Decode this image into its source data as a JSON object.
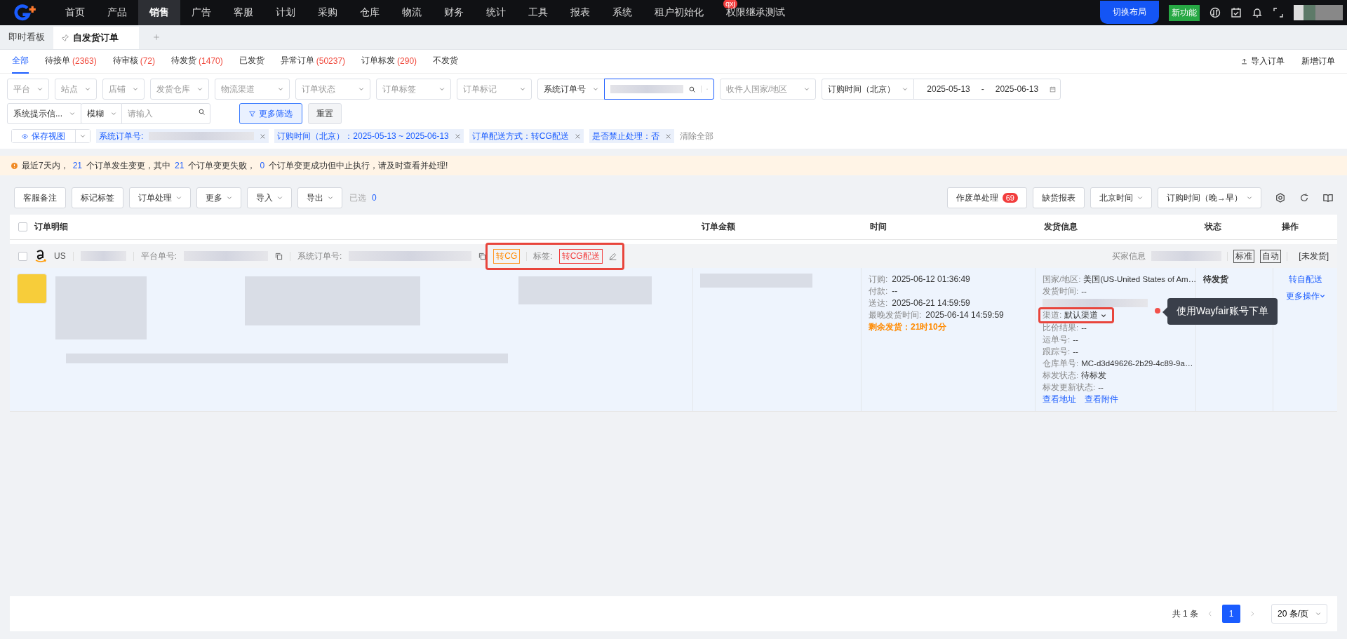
{
  "top_nav": {
    "items": [
      {
        "label": "首页",
        "selected": false
      },
      {
        "label": "产品",
        "selected": false
      },
      {
        "label": "销售",
        "selected": true
      },
      {
        "label": "广告",
        "selected": false
      },
      {
        "label": "客服",
        "selected": false
      },
      {
        "label": "计划",
        "selected": false
      },
      {
        "label": "采购",
        "selected": false
      },
      {
        "label": "仓库",
        "selected": false
      },
      {
        "label": "物流",
        "selected": false
      },
      {
        "label": "财务",
        "selected": false
      },
      {
        "label": "统计",
        "selected": false
      },
      {
        "label": "工具",
        "selected": false
      },
      {
        "label": "报表",
        "selected": false
      },
      {
        "label": "系统",
        "selected": false
      },
      {
        "label": "租户初始化",
        "selected": false
      },
      {
        "label": "权限继承测试",
        "selected": false,
        "badge": "qxj"
      }
    ],
    "switch_layout": "切换布局",
    "new_feature": "新功能"
  },
  "page_tabs": [
    {
      "label": "即时看板",
      "selected": false,
      "pinned": false
    },
    {
      "label": "自发货订单",
      "selected": true,
      "pinned": true
    }
  ],
  "status_tabs": [
    {
      "label": "全部",
      "selected": true
    },
    {
      "label": "待接单",
      "count": "(2363)",
      "selected": false
    },
    {
      "label": "待审核",
      "count": "(72)",
      "selected": false
    },
    {
      "label": "待发货",
      "count": "(1470)",
      "selected": false
    },
    {
      "label": "已发货",
      "selected": false
    },
    {
      "label": "异常订单",
      "count": "(50237)",
      "selected": false
    },
    {
      "label": "订单标发",
      "count": "(290)",
      "selected": false
    },
    {
      "label": "不发货",
      "selected": false
    }
  ],
  "header_actions": [
    {
      "label": "导入订单",
      "kind": "upload"
    },
    {
      "label": "新增订单",
      "kind": "plain"
    }
  ],
  "filter_rows": [
    [
      {
        "kind": "select",
        "placeholder": "平台"
      },
      {
        "kind": "select",
        "placeholder": "站点"
      },
      {
        "kind": "select",
        "placeholder": "店铺"
      },
      {
        "kind": "select",
        "placeholder": "发货仓库"
      },
      {
        "kind": "select",
        "placeholder": "物流渠道",
        "wide": true
      },
      {
        "kind": "select",
        "placeholder": "订单状态",
        "wide": true
      },
      {
        "kind": "select",
        "placeholder": "订单标签",
        "wide": true
      },
      {
        "kind": "select",
        "placeholder": "订单标记",
        "wide": true
      },
      {
        "kind": "group",
        "items": [
          {
            "kind": "select",
            "value": "系统订单号"
          },
          {
            "kind": "search",
            "redacted": true,
            "focused": true,
            "more": true
          }
        ]
      },
      {
        "kind": "select",
        "placeholder": "收件人国家/地区",
        "wide": true
      },
      {
        "kind": "group",
        "items": [
          {
            "kind": "select",
            "value": "订购时间（北京）"
          },
          {
            "kind": "daterange",
            "start": "2025-05-13",
            "separator": "-",
            "end": "2025-06-13"
          }
        ]
      }
    ],
    [
      {
        "kind": "group",
        "items": [
          {
            "kind": "select",
            "value": "系统提示信..."
          },
          {
            "kind": "select",
            "value": "模糊"
          },
          {
            "kind": "search",
            "placeholder": "请输入"
          }
        ]
      },
      {
        "kind": "button",
        "label": "更多筛选",
        "primary": true
      },
      {
        "kind": "button",
        "label": "重置",
        "primary": false
      }
    ]
  ],
  "save_view": "保存视图",
  "chips": [
    {
      "label": "系统订单号:",
      "redacted": true
    },
    {
      "label": "订购时间（北京）：2025-05-13 ~ 2025-06-13"
    },
    {
      "label": "订单配送方式：转CG配送"
    },
    {
      "label": "是否禁止处理：否"
    }
  ],
  "clear_all": "清除全部",
  "alert": [
    {
      "kind": "text",
      "text": "最近7天内，"
    },
    {
      "kind": "count",
      "text": "21"
    },
    {
      "kind": "text",
      "text": "个订单发生变更，其中"
    },
    {
      "kind": "count",
      "text": "21"
    },
    {
      "kind": "text",
      "text": "个订单变更失败，"
    },
    {
      "kind": "count",
      "text": "0"
    },
    {
      "kind": "text",
      "text": "个订单变更成功但中止执行，请及时查看并处理!"
    }
  ],
  "toolbar": {
    "left": [
      {
        "label": "客服备注",
        "dropdown": false
      },
      {
        "label": "标记标签",
        "dropdown": false
      },
      {
        "label": "订单处理",
        "dropdown": true
      },
      {
        "label": "更多",
        "dropdown": true
      },
      {
        "label": "导入",
        "dropdown": true
      },
      {
        "label": "导出",
        "dropdown": true
      }
    ],
    "selected_label": "已选",
    "selected_count": "0",
    "right": [
      {
        "label": "作废单处理",
        "badge": "69",
        "dropdown": false
      },
      {
        "label": "缺货报表",
        "dropdown": false
      },
      {
        "label": "北京时间",
        "dropdown": true
      },
      {
        "label": "订购时间（晚→早）",
        "dropdown": true
      }
    ]
  },
  "table": {
    "select_all_checked": false,
    "columns": [
      "订单明细",
      "订单金额",
      "时间",
      "发货信息",
      "状态",
      "操作"
    ],
    "order": {
      "checked": false,
      "site": "US",
      "platform_no_label": "平台单号:",
      "system_no_label": "系统订单号:",
      "flag": "转CG",
      "tag_label": "标签:",
      "tag": "转CG配送",
      "highlighted": true,
      "buyer_label": "买家信息",
      "modes": [
        "标准",
        "自动"
      ],
      "ship_status": "[未发货]",
      "times": [
        {
          "label": "订购:",
          "text": "2025-06-12 01:36:49"
        },
        {
          "label": "付款:",
          "text": "--"
        },
        {
          "label": "送达:",
          "text": "2025-06-21 14:59:59"
        },
        {
          "label": "最晚发货时间:",
          "text": "2025-06-14 14:59:59"
        }
      ],
      "remaining": "剩余发货：21时10分",
      "shipping": [
        {
          "kind": "text",
          "label": "国家/地区:",
          "text": "美国(US-United States of Am…"
        },
        {
          "kind": "text",
          "label": "发货时间:",
          "text": "--"
        },
        {
          "kind": "redacted"
        },
        {
          "kind": "channel",
          "label": "渠道:",
          "value": "默认渠道",
          "highlighted": true
        },
        {
          "kind": "text",
          "label": "比价结果:",
          "text": "--"
        },
        {
          "kind": "text",
          "label": "运单号:",
          "text": "--"
        },
        {
          "kind": "text",
          "label": "跟踪号:",
          "text": "--"
        },
        {
          "kind": "text",
          "label": "仓库单号:",
          "text": "MC-d3d49626-2b29-4c89-9a…"
        },
        {
          "kind": "text",
          "label": "标发状态:",
          "text": "待标发"
        },
        {
          "kind": "text",
          "label": "标发更新状态:",
          "text": "--"
        },
        {
          "kind": "links",
          "links": [
            "查看地址",
            "查看附件"
          ]
        }
      ],
      "status": "待发货",
      "operations": [
        "转自配送",
        "更多操作"
      ],
      "note": "使用Wayfair账号下单"
    }
  },
  "pagination": {
    "total": "共 1 条",
    "pages": [
      {
        "label": "1",
        "selected": true
      }
    ],
    "page_size": "20 条/页"
  }
}
